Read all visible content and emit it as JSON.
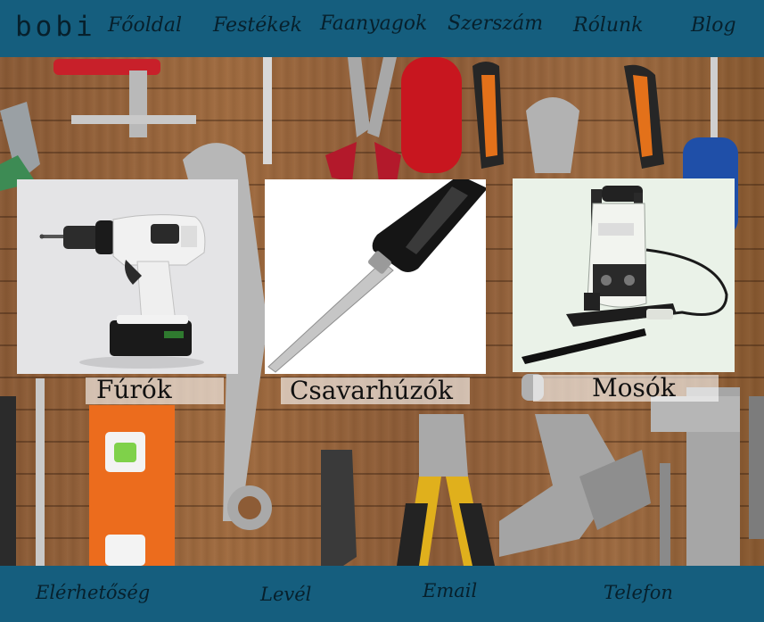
{
  "header": {
    "logo": "bobi",
    "nav": [
      {
        "label": "Főoldal"
      },
      {
        "label": "Festékek"
      },
      {
        "label": "Faanyagok"
      },
      {
        "label": "Szerszám"
      },
      {
        "label": "Rólunk"
      },
      {
        "label": "Blog"
      }
    ]
  },
  "products": [
    {
      "label": "Fúrók",
      "icon": "drill"
    },
    {
      "label": "Csavarhúzók",
      "icon": "screwdriver"
    },
    {
      "label": "Mosók",
      "icon": "pressure-washer"
    }
  ],
  "footer": {
    "items": [
      {
        "label": "Elérhetőség"
      },
      {
        "label": "Levél"
      },
      {
        "label": "Email"
      },
      {
        "label": "Telefon"
      }
    ]
  },
  "colors": {
    "bar": "#155e7e",
    "bar_text": "#07202c",
    "wood": "#9a6a40"
  }
}
